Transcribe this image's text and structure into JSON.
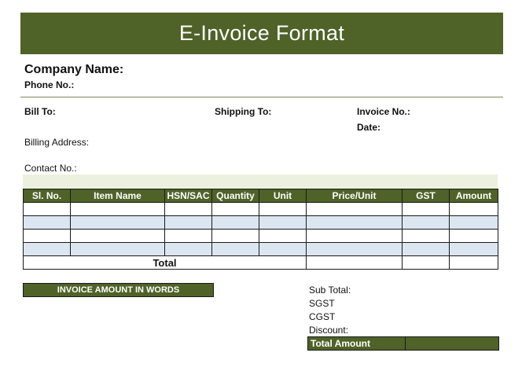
{
  "title": "E-Invoice Format",
  "company": {
    "name_label": "Company Name:",
    "phone_label": "Phone No.:"
  },
  "fields": {
    "bill_to": "Bill To:",
    "shipping_to": "Shipping To:",
    "invoice_no": "Invoice No.:",
    "date": "Date:",
    "billing_address": "Billing Address:",
    "contact_no": "Contact No.:"
  },
  "table": {
    "headers": [
      "Sl. No.",
      "Item Name",
      "HSN/SAC",
      "Quantity",
      "Unit",
      "Price/Unit",
      "GST",
      "Amount"
    ],
    "total_label": "Total"
  },
  "words_label": "INVOICE AMOUNT IN WORDS",
  "summary": {
    "sub_total": "Sub Total:",
    "sgst": "SGST",
    "cgst": "CGST",
    "discount": "Discount:",
    "total_amount": "Total Amount"
  },
  "colors": {
    "accent": "#4f6228",
    "tint": "#ebf1de",
    "stripe": "#dce6f1"
  }
}
